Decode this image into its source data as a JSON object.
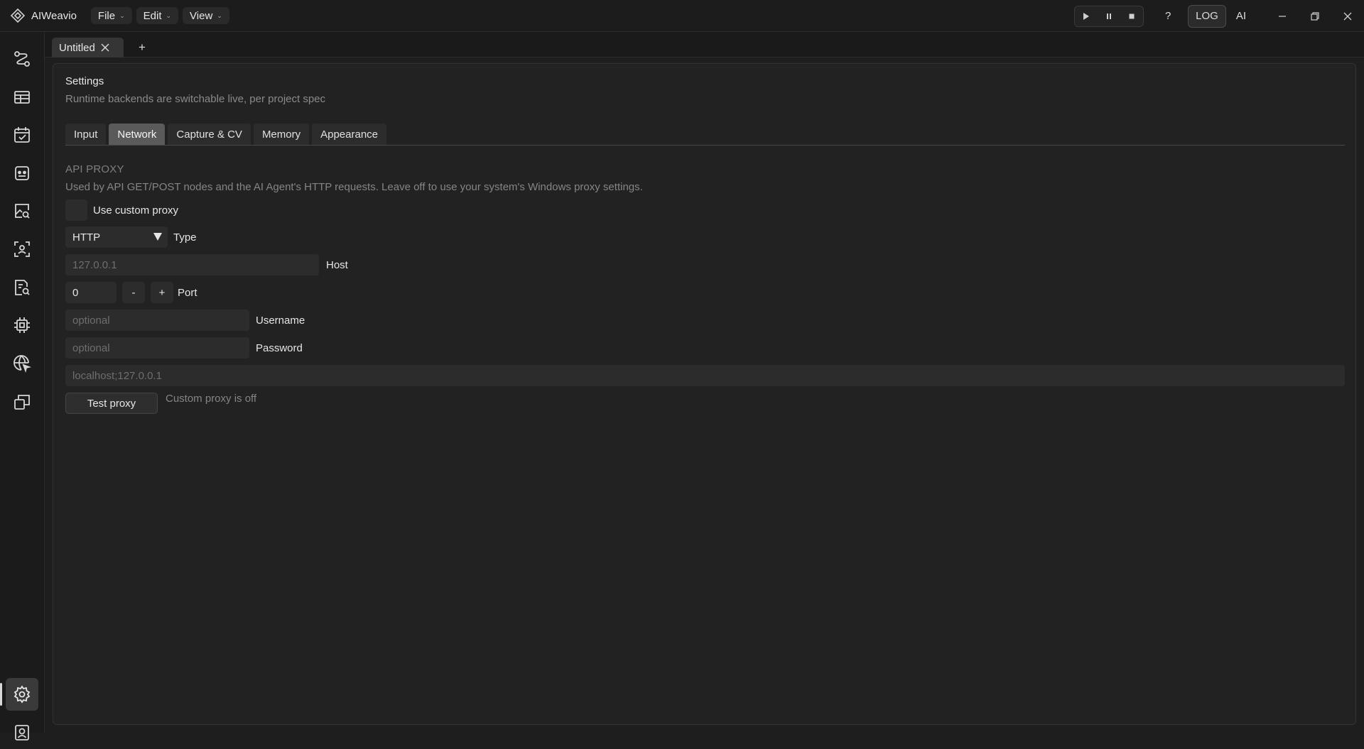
{
  "app": {
    "title": "AIWeavio",
    "menus": [
      {
        "label": "File"
      },
      {
        "label": "Edit"
      },
      {
        "label": "View"
      }
    ],
    "toolbar": {
      "help": "?",
      "log": "LOG",
      "ai": "AI"
    }
  },
  "sidebar": {
    "items": [
      {
        "icon": "nodes-icon"
      },
      {
        "icon": "layout-icon"
      },
      {
        "icon": "calendar-check-icon"
      },
      {
        "icon": "robot-icon"
      },
      {
        "icon": "image-search-icon"
      },
      {
        "icon": "face-scan-icon"
      },
      {
        "icon": "document-search-icon"
      },
      {
        "icon": "chip-icon"
      },
      {
        "icon": "globe-cursor-icon"
      },
      {
        "icon": "windows-icon"
      }
    ],
    "bottom": [
      {
        "icon": "gear-icon",
        "active": true
      },
      {
        "icon": "user-badge-icon"
      }
    ]
  },
  "document_tabs": [
    {
      "label": "Untitled"
    }
  ],
  "settings": {
    "title": "Settings",
    "subtitle": "Runtime backends are switchable live, per project spec",
    "tabs": [
      {
        "label": "Input"
      },
      {
        "label": "Network",
        "active": true
      },
      {
        "label": "Capture & CV"
      },
      {
        "label": "Memory"
      },
      {
        "label": "Appearance"
      }
    ],
    "proxy": {
      "section": "API PROXY",
      "description": "Used by API GET/POST nodes and the AI Agent's HTTP requests. Leave off to use your system's Windows proxy settings.",
      "use_custom_label": "Use custom proxy",
      "use_custom": false,
      "type_value": "HTTP",
      "type_label": "Type",
      "host_placeholder": "127.0.0.1",
      "host_label": "Host",
      "port_value": "0",
      "port_minus": "-",
      "port_plus": "+",
      "port_label": "Port",
      "username_placeholder": "optional",
      "username_label": "Username",
      "password_placeholder": "optional",
      "password_label": "Password",
      "bypass_placeholder": "localhost;127.0.0.1",
      "test_button": "Test proxy",
      "status": "Custom proxy is off"
    }
  },
  "colors": {
    "background": "#1e1e1e",
    "panel": "#222222",
    "active_tab": "#5a5a5a",
    "field": "#2c2c2c"
  }
}
